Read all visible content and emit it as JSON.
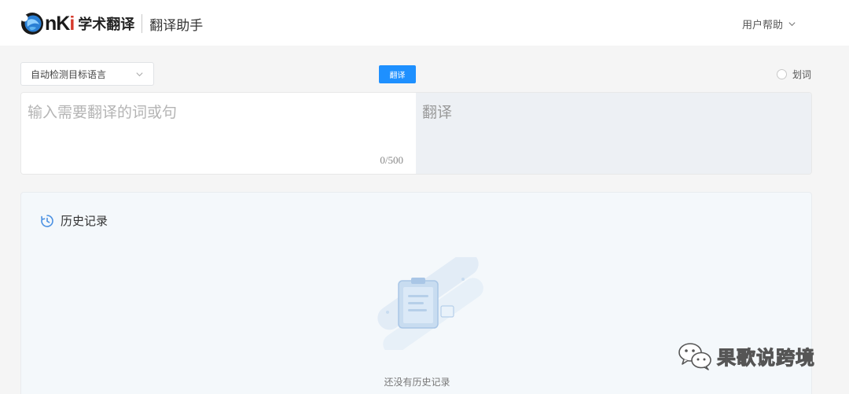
{
  "header": {
    "logo_nk": "n",
    "logo_k": "K",
    "logo_i": "i",
    "logo_text": "学术翻译",
    "subtitle": "翻译助手",
    "help_label": "用户帮助"
  },
  "toolbar": {
    "language_select": "自动检测目标语言",
    "translate_button": "翻译",
    "word_toggle_label": "划词"
  },
  "input": {
    "placeholder": "输入需要翻译的词或句",
    "counter": "0/500"
  },
  "output": {
    "label": "翻译"
  },
  "history": {
    "title": "历史记录",
    "empty_text": "还没有历史记录"
  },
  "watermark": {
    "text": "果歌说跨境"
  },
  "colors": {
    "accent": "#1e90ff",
    "logo_red": "#d63a2c",
    "output_bg": "#edf0f4",
    "history_bg": "#f4f8fb"
  },
  "icons": [
    "globe-logo-icon",
    "chevron-down-icon",
    "clock-history-icon",
    "empty-clipboard-illustration",
    "wechat-watermark-icon"
  ]
}
